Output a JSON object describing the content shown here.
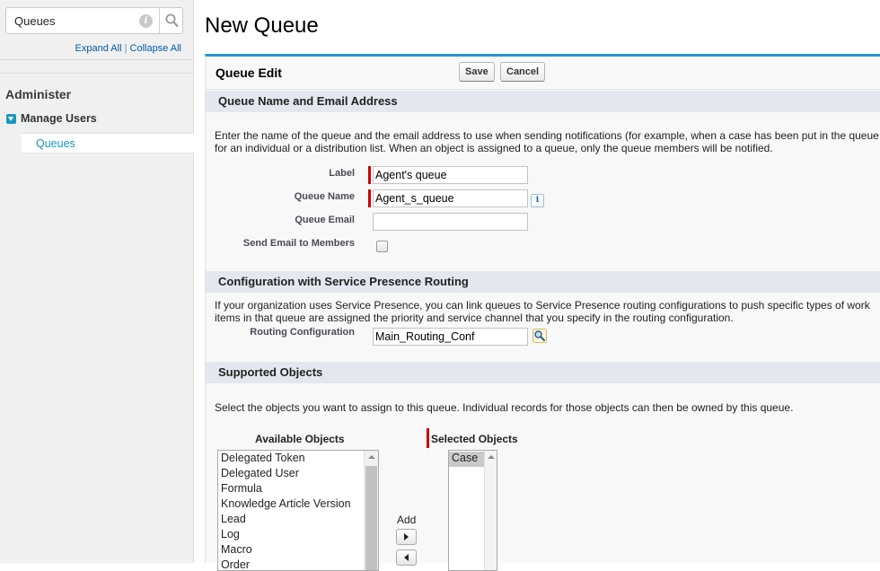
{
  "sidebar": {
    "search_value": "Queues",
    "expand_all": "Expand All",
    "separator": "|",
    "collapse_all": "Collapse All",
    "section_heading": "Administer",
    "group": "Manage Users",
    "active_item": "Queues"
  },
  "page": {
    "title": "New Queue"
  },
  "panel": {
    "title": "Queue Edit",
    "save_label": "Save",
    "cancel_label": "Cancel"
  },
  "section_name": {
    "heading": "Queue Name and Email Address",
    "desc_line1": "Enter the name of the queue and the email address to use when sending notifications (for example, when a case has been put in the queue",
    "desc_line2": "for an individual or a distribution list. When an object is assigned to a queue, only the queue members will be notified.",
    "label_label": "Label",
    "label_value": "Agent's queue",
    "queue_name_label": "Queue Name",
    "queue_name_value": "Agent_s_queue",
    "queue_email_label": "Queue Email",
    "queue_email_value": "",
    "send_email_label": "Send Email to Members",
    "send_email_checked": false
  },
  "section_routing": {
    "heading": "Configuration with Service Presence Routing",
    "desc_line1": "If your organization uses Service Presence, you can link queues to Service Presence routing configurations to push specific types of work",
    "desc_line2": "items in that queue are assigned the priority and service channel that you specify in the routing configuration.",
    "routing_label": "Routing Configuration",
    "routing_value": "Main_Routing_Conf"
  },
  "section_objects": {
    "heading": "Supported Objects",
    "desc": "Select the objects you want to assign to this queue. Individual records for those objects can then be owned by this queue.",
    "available_label": "Available Objects",
    "selected_label": "Selected Objects",
    "available_items": [
      "Delegated Token",
      "Delegated User",
      "Formula",
      "Knowledge Article Version",
      "Lead",
      "Log",
      "Macro",
      "Order"
    ],
    "selected_items": [
      "Case"
    ],
    "add_label": "Add"
  },
  "colors": {
    "accent": "#2a94d6",
    "link": "#015ba7",
    "required": "#cc0000",
    "section_bg": "#e4e7ee"
  }
}
